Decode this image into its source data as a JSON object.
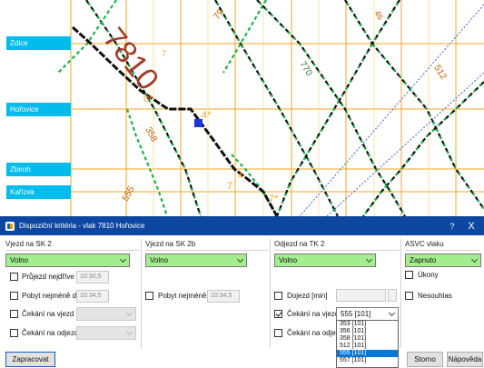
{
  "graph": {
    "stations": [
      "Zdice",
      "Hořovice",
      "Zbiroh",
      "Kařízek"
    ],
    "train_label": "7810",
    "track_labels": [
      "770",
      "358",
      "555",
      "512",
      "7*",
      "4*",
      "0*",
      "7",
      "79",
      "4",
      "46",
      "7"
    ]
  },
  "dialog": {
    "title": "Dispoziční kritéria - vlak 7810 Hořovice",
    "help": "?",
    "close": "X",
    "col1": {
      "header": "Vjezd na SK 2",
      "select_value": "Volno",
      "pass_label": "Průjezd nejdříve po:",
      "pass_value": "10:30,5",
      "stay_label": "Pobyt nejméně do:",
      "stay_value": "10:34,5",
      "wait_in_label": "Čekání na vjezd",
      "wait_out_label": "Čekání na odjezd"
    },
    "col2": {
      "header": "Vjezd na SK 2b",
      "select_value": "Volno",
      "stay_label": "Pobyt nejméně do:",
      "stay_value": "10:34,5"
    },
    "col3": {
      "header": "Odjezd na TK 2",
      "select_value": "Volno",
      "dojezd_label": "Dojezd [min]",
      "wait_in_label": "Čekání na vjezd",
      "wait_in_value": "555 [101]",
      "wait_out_label": "Čekání na odjezd",
      "options": [
        "353 [101]",
        "356 [101]",
        "358 [101]",
        "512 [101]",
        "555 [101]",
        "557 [101]"
      ],
      "selected_index": 4
    },
    "col4": {
      "header": "ASVC vlaku",
      "select_value": "Zapnuto",
      "ukony_label": "Úkony",
      "nesouhlas_label": "Nesouhlas"
    },
    "buttons": {
      "process": "Zapracovat",
      "cancel": "Storno",
      "help": "Nápověda"
    }
  },
  "colors": {
    "titlebar": "#0d47a1",
    "station_tag": "#00bcec",
    "grid_orange": "#f5a623",
    "train_brown": "#a03c2a",
    "track_green": "#22b14c",
    "selected_combo": "#a2ed8d",
    "list_highlight": "#0078d7"
  }
}
